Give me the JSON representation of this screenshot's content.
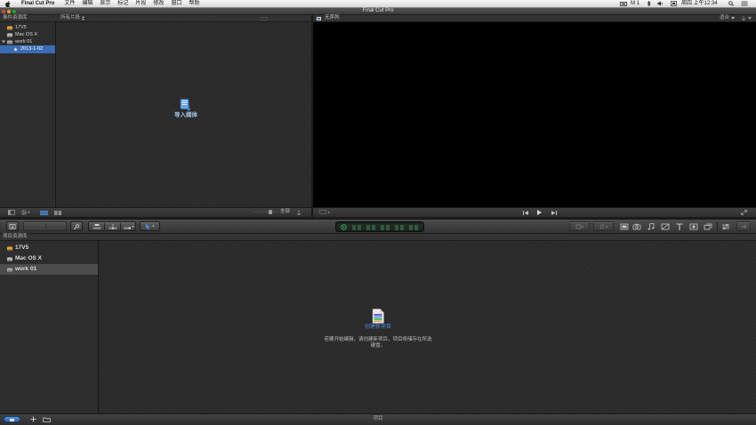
{
  "menubar": {
    "app_name": "Final Cut Pro",
    "menus": [
      "文件",
      "编辑",
      "显示",
      "标记",
      "片段",
      "修改",
      "窗口",
      "帮助"
    ],
    "status_label": "M 1",
    "clock": "周四 上午12:34"
  },
  "window": {
    "title": "Final Cut Pro"
  },
  "event_library": {
    "header": "事件资源库",
    "items": [
      {
        "label": "17V5"
      },
      {
        "label": "Mac OS X"
      },
      {
        "label": "work 01"
      },
      {
        "label": "2013-1-02",
        "selected": true
      }
    ]
  },
  "event_browser": {
    "filter_label": "所有片段",
    "import_label": "导入媒体",
    "duration_label": "全部"
  },
  "viewer": {
    "title": "无序列",
    "zoom_label": "适合"
  },
  "project_library": {
    "header": "项目资源库",
    "items": [
      {
        "label": "17V5"
      },
      {
        "label": "Mac OS X"
      },
      {
        "label": "work 01",
        "selected": true
      }
    ],
    "create_label": "创建新项目",
    "hint_lines": [
      "若要开始编辑，请创建新项目，项目将储存在所选",
      "硬盘。"
    ],
    "footer_label": "项目"
  },
  "colors": {
    "selection": "#3a6cb4",
    "link_blue": "#4f8fd8",
    "timecode_green": "#3cb45a",
    "drive_orange": "#e8a13a"
  }
}
